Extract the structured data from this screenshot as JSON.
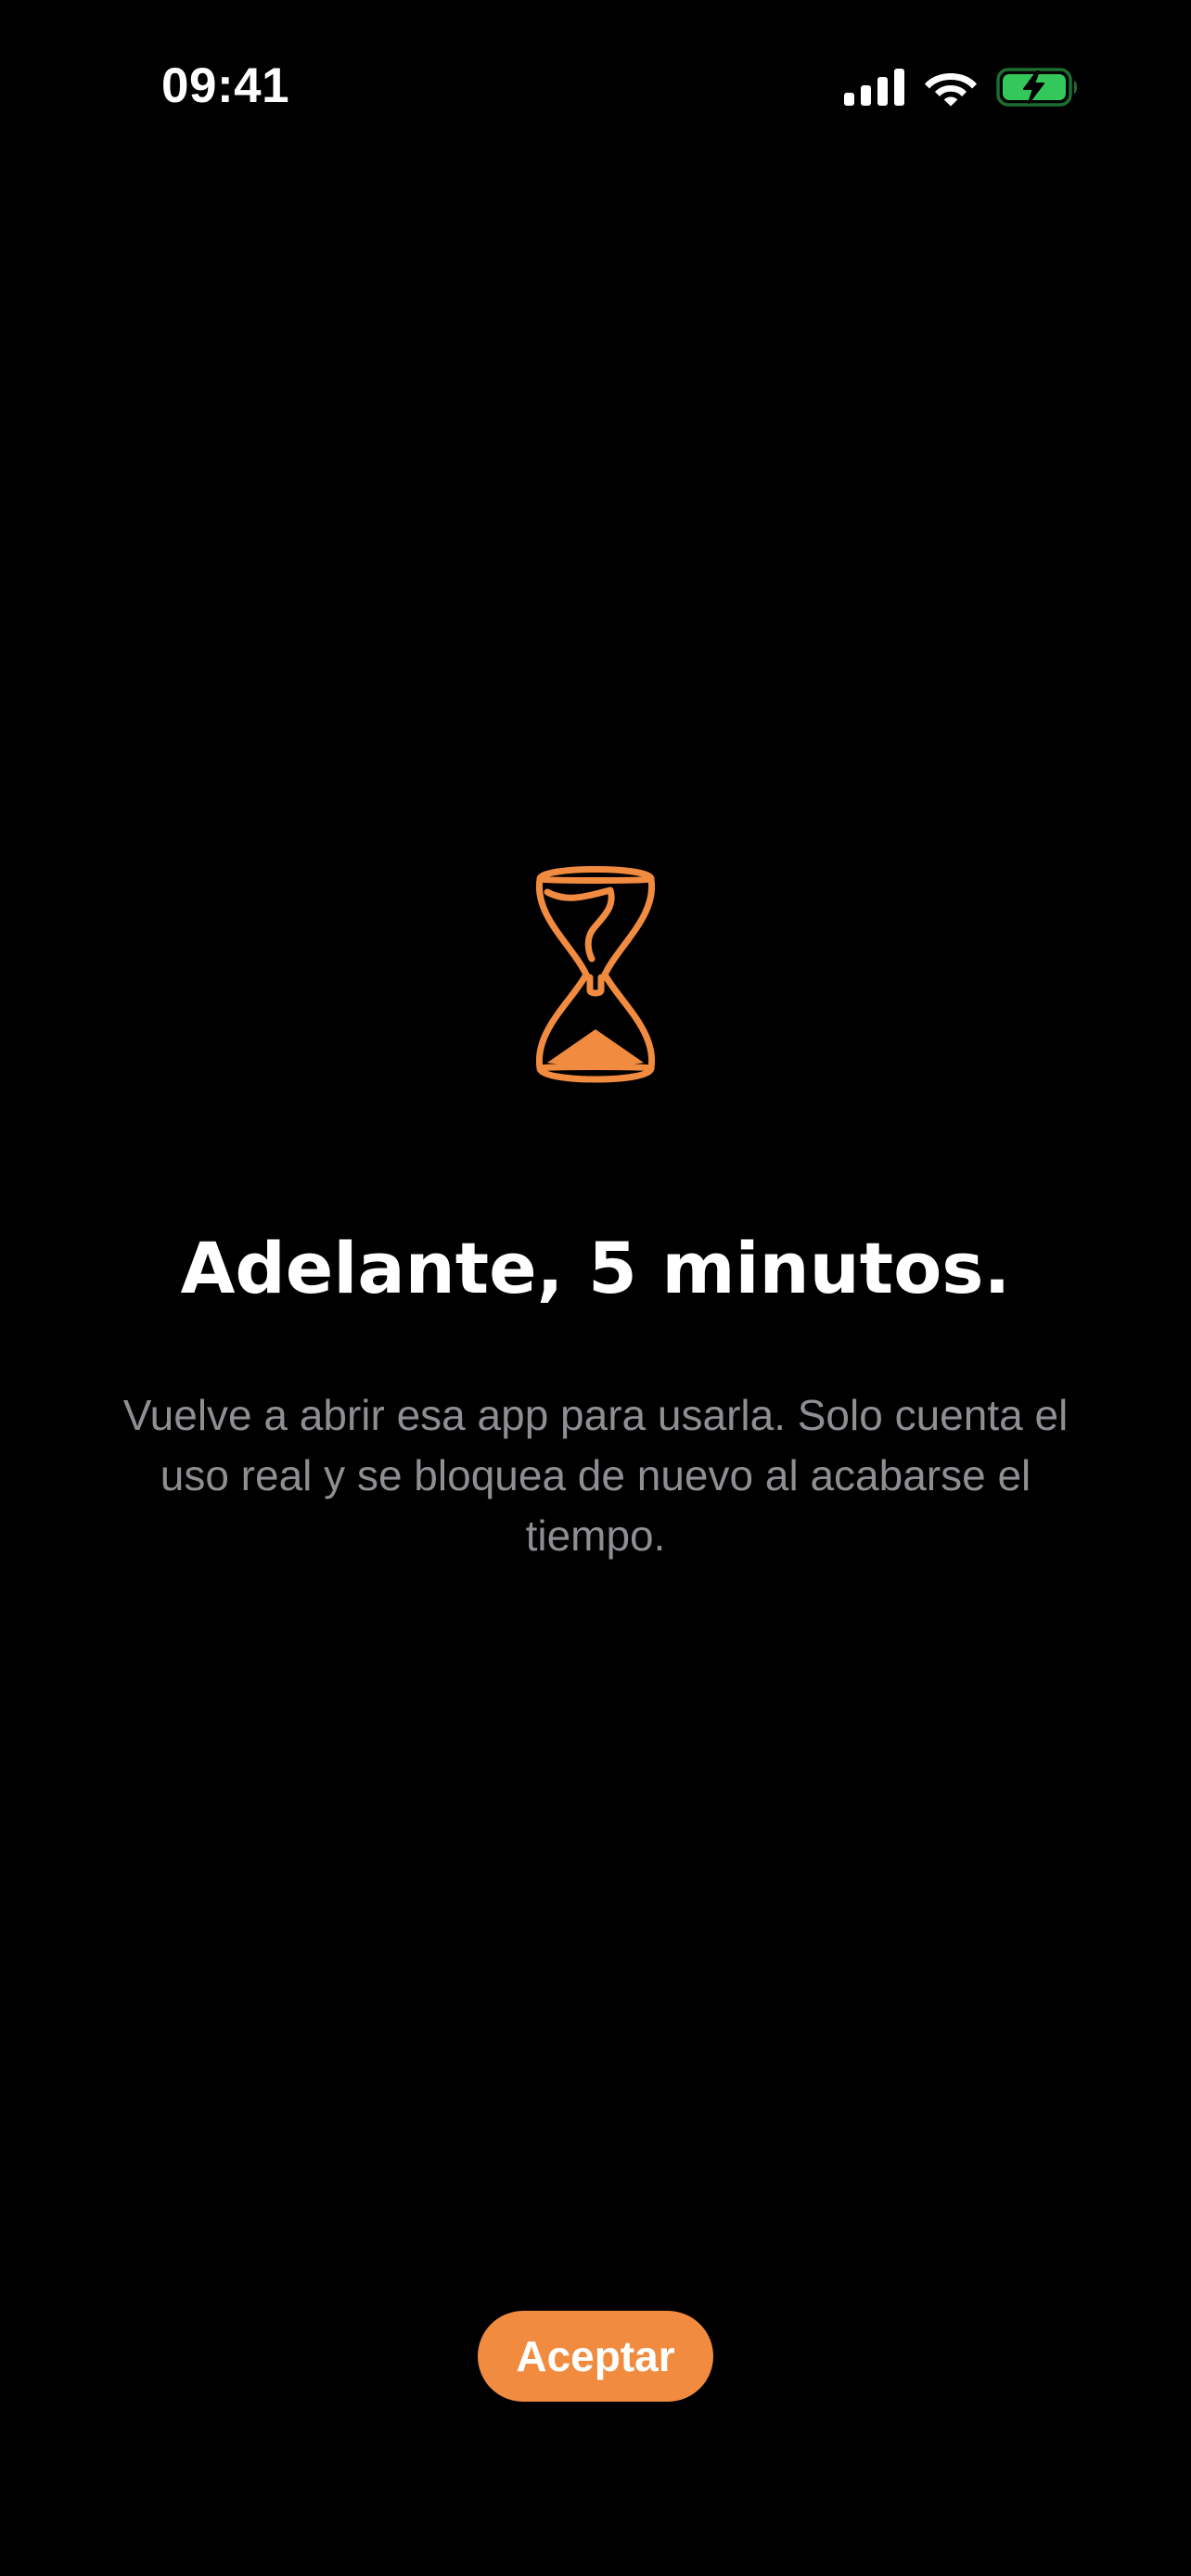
{
  "status_bar": {
    "time": "09:41",
    "icons": [
      "cellular-signal-icon",
      "wifi-icon",
      "battery-charging-icon"
    ],
    "battery_color": "#34C759"
  },
  "main": {
    "icon": "hourglass-icon",
    "accent_color": "#F18B40",
    "title": "Adelante, 5 minutos.",
    "description": "Vuelve a abrir esa app para usarla. Solo cuenta el uso real y se bloquea de nuevo al acabarse el tiempo.",
    "accept_label": "Aceptar"
  }
}
